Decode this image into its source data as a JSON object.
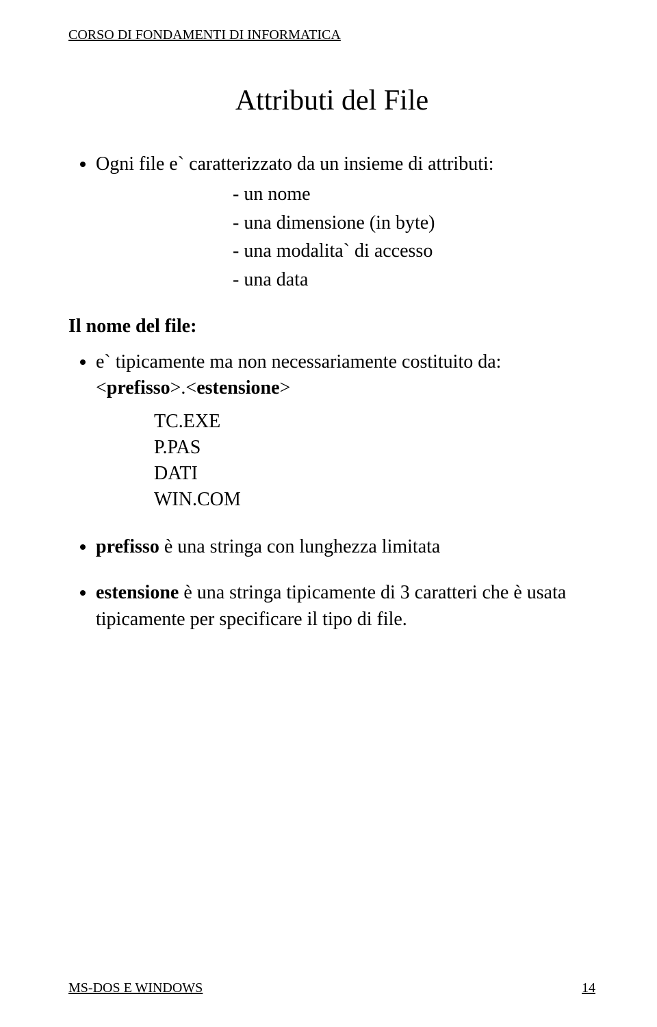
{
  "header": "CORSO DI FONDAMENTI DI INFORMATICA",
  "title": "Attributi del File",
  "intro_lead": "Ogni file e` caratterizzato da un insieme di attributi:",
  "attributes": [
    "- un nome",
    "- una dimensione (in byte)",
    "- una modalita` di accesso",
    "- una data"
  ],
  "filename_heading": "Il nome del file:",
  "filename_desc": "e` tipicamente ma non necessariamente costituito da: ",
  "syntax_open": "<",
  "syntax_prefix": "prefisso",
  "syntax_mid": ">.<",
  "syntax_ext": "estensione",
  "syntax_close": ">",
  "examples": [
    "TC.EXE",
    "P.PAS",
    "DATI",
    "WIN.COM"
  ],
  "note_prefix_bold": "prefisso",
  "note_prefix_rest": " è una stringa con lunghezza limitata",
  "note_ext_bold": "estensione",
  "note_ext_rest": " è una stringa tipicamente di 3 caratteri che è usata tipicamente per specificare il tipo di file.",
  "footer_left": "MS-DOS  E WINDOWS",
  "footer_right": "14"
}
